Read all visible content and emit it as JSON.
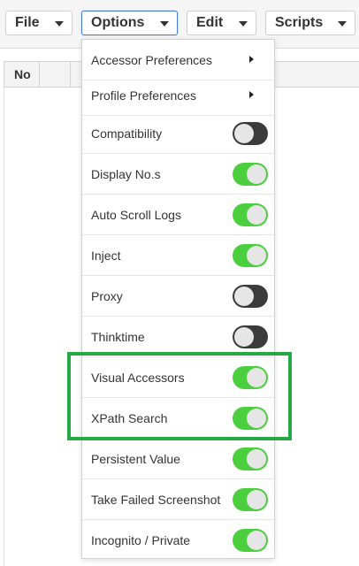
{
  "menubar": {
    "file_label": "File",
    "options_label": "Options",
    "edit_label": "Edit",
    "scripts_label": "Scripts"
  },
  "table": {
    "col_no": "No"
  },
  "options_menu": {
    "items": [
      {
        "label": "Accessor Preferences",
        "type": "submenu"
      },
      {
        "label": "Profile Preferences",
        "type": "submenu"
      },
      {
        "label": "Compatibility",
        "type": "toggle",
        "on": false
      },
      {
        "label": "Display No.s",
        "type": "toggle",
        "on": true
      },
      {
        "label": "Auto Scroll Logs",
        "type": "toggle",
        "on": true
      },
      {
        "label": "Inject",
        "type": "toggle",
        "on": true
      },
      {
        "label": "Proxy",
        "type": "toggle",
        "on": false
      },
      {
        "label": "Thinktime",
        "type": "toggle",
        "on": false
      },
      {
        "label": "Visual Accessors",
        "type": "toggle",
        "on": true,
        "highlighted": true
      },
      {
        "label": "XPath Search",
        "type": "toggle",
        "on": true,
        "highlighted": true
      },
      {
        "label": "Persistent Value",
        "type": "toggle",
        "on": true
      },
      {
        "label": "Take Failed Screenshot",
        "type": "toggle",
        "on": true
      },
      {
        "label": "Incognito / Private",
        "type": "toggle",
        "on": true
      }
    ]
  },
  "colors": {
    "toggle_on": "#4bcf3e",
    "toggle_off": "#3b3b3b",
    "highlight_frame": "#27a846",
    "active_menu_border": "#4a7fd4"
  },
  "icons": {
    "caret": "caret-down-icon",
    "submenu_arrow": "chevron-right-icon"
  }
}
